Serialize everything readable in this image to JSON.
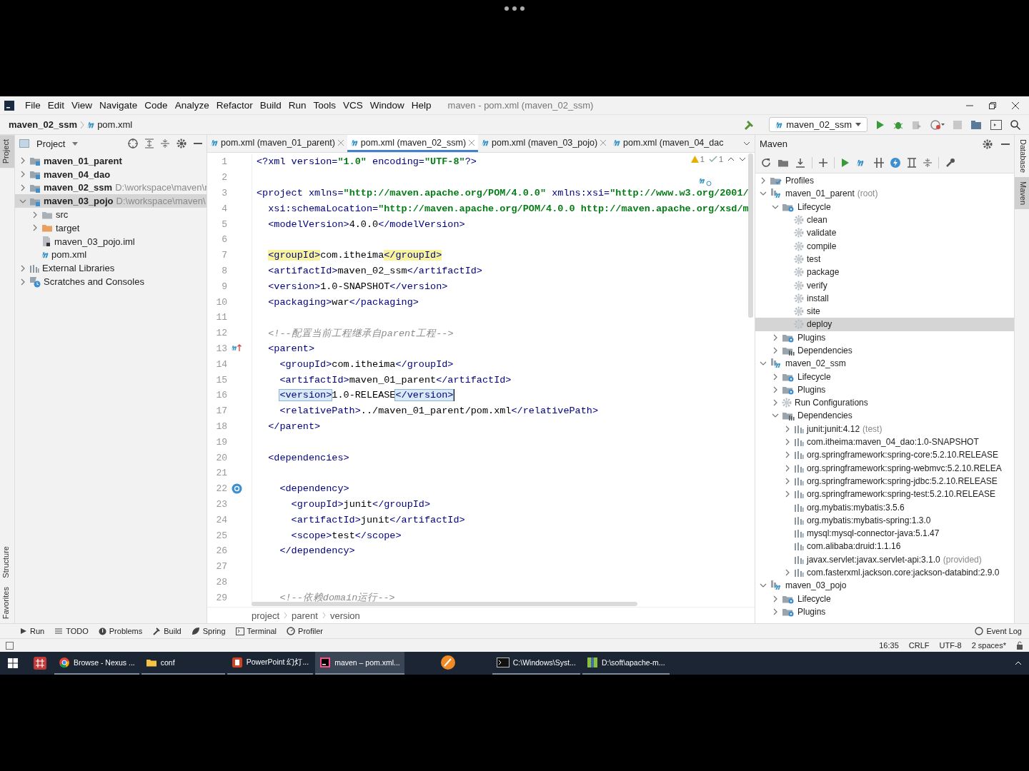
{
  "window": {
    "title": "maven - pom.xml (maven_02_ssm)"
  },
  "menu": [
    "File",
    "Edit",
    "View",
    "Navigate",
    "Code",
    "Analyze",
    "Refactor",
    "Build",
    "Run",
    "Tools",
    "VCS",
    "Window",
    "Help"
  ],
  "nav": {
    "module": "maven_02_ssm",
    "file": "pom.xml"
  },
  "toolbar": {
    "run_config": "maven_02_ssm"
  },
  "left_stripe": [
    {
      "label": "Project",
      "selected": true
    },
    {
      "label": "Structure",
      "selected": false
    },
    {
      "label": "Favorites",
      "selected": false
    }
  ],
  "right_stripe": [
    {
      "label": "Database",
      "selected": false
    },
    {
      "label": "Maven",
      "selected": true
    }
  ],
  "project": {
    "title": "Project",
    "tree": [
      {
        "label": "maven_01_parent",
        "kind": "module",
        "expanded": false,
        "selected": false
      },
      {
        "label": "maven_04_dao",
        "kind": "module",
        "expanded": false,
        "selected": false
      },
      {
        "label": "maven_02_ssm",
        "path": "D:\\workspace\\maven\\r",
        "kind": "module",
        "expanded": false,
        "selected": false
      },
      {
        "label": "maven_03_pojo",
        "path": "D:\\workspace\\maven\\",
        "kind": "module",
        "expanded": true,
        "selected": true,
        "children": [
          {
            "label": "src",
            "kind": "folder",
            "expanded": false
          },
          {
            "label": "target",
            "kind": "excluded",
            "expanded": false
          },
          {
            "label": "maven_03_pojo.iml",
            "kind": "iml"
          },
          {
            "label": "pom.xml",
            "kind": "pom"
          }
        ]
      },
      {
        "label": "External Libraries",
        "kind": "libraries",
        "expanded": false,
        "selected": false
      },
      {
        "label": "Scratches and Consoles",
        "kind": "scratches",
        "expanded": false,
        "selected": false
      }
    ]
  },
  "tabs": [
    {
      "label": "pom.xml (maven_01_parent)",
      "selected": false,
      "closable": true
    },
    {
      "label": "pom.xml (maven_02_ssm)",
      "selected": true,
      "closable": true
    },
    {
      "label": "pom.xml (maven_03_pojo)",
      "selected": false,
      "closable": true
    },
    {
      "label": "pom.xml (maven_04_dac",
      "selected": false,
      "closable": false
    }
  ],
  "editor": {
    "warnings": "1",
    "weak_warnings": "1",
    "lines": [
      {
        "n": "1",
        "text": "<?xml version=\"1.0\" encoding=\"UTF-8\"?>"
      },
      {
        "n": "2"
      },
      {
        "n": "3",
        "text": "<project xmlns=\"http://maven.apache.org/POM/4.0.0\" xmlns:xsi=\"http://www.w3.org/2001/"
      },
      {
        "n": "4",
        "text": "  xsi:schemaLocation=\"http://maven.apache.org/POM/4.0.0 http://maven.apache.org/xsd/m"
      },
      {
        "n": "5",
        "text": "  <modelVersion>4.0.0</modelVersion>"
      },
      {
        "n": "6"
      },
      {
        "n": "7",
        "text": "  <groupId>com.itheima</groupId>",
        "tag_match": true
      },
      {
        "n": "8",
        "text": "  <artifactId>maven_02_ssm</artifactId>"
      },
      {
        "n": "9",
        "text": "  <version>1.0-SNAPSHOT</version>"
      },
      {
        "n": "10",
        "text": "  <packaging>war</packaging>"
      },
      {
        "n": "11"
      },
      {
        "n": "12",
        "text": "  <!--配置当前工程继承自parent工程-->"
      },
      {
        "n": "13",
        "text": "  <parent>",
        "override_marker": true
      },
      {
        "n": "14",
        "text": "    <groupId>com.itheima</groupId>"
      },
      {
        "n": "15",
        "text": "    <artifactId>maven_01_parent</artifactId>"
      },
      {
        "n": "16",
        "text": "    <version>1.0-RELEASE</version>",
        "tag_pair": true,
        "caret": true
      },
      {
        "n": "17",
        "text": "    <relativePath>../maven_01_parent/pom.xml</relativePath>"
      },
      {
        "n": "18",
        "text": "  </parent>"
      },
      {
        "n": "19"
      },
      {
        "n": "20",
        "text": "  <dependencies>"
      },
      {
        "n": "21"
      },
      {
        "n": "22",
        "text": "    <dependency>",
        "dependency_marker": true
      },
      {
        "n": "23",
        "text": "      <groupId>junit</groupId>"
      },
      {
        "n": "24",
        "text": "      <artifactId>junit</artifactId>"
      },
      {
        "n": "25",
        "text": "      <scope>test</scope>"
      },
      {
        "n": "26",
        "text": "    </dependency>"
      },
      {
        "n": "27"
      },
      {
        "n": "28"
      },
      {
        "n": "29",
        "text": "    <!--依赖domain运行-->"
      }
    ],
    "breadcrumb": [
      "project",
      "parent",
      "version"
    ]
  },
  "maven": {
    "title": "Maven",
    "tree": [
      {
        "label": "Profiles",
        "kind": "profiles",
        "expanded": false
      },
      {
        "label": "maven_01_parent",
        "note": "(root)",
        "kind": "project",
        "expanded": true,
        "children": [
          {
            "label": "Lifecycle",
            "kind": "lifecycle",
            "expanded": true,
            "children": [
              {
                "label": "clean",
                "kind": "goal",
                "selected": false
              },
              {
                "label": "validate",
                "kind": "goal",
                "selected": false
              },
              {
                "label": "compile",
                "kind": "goal",
                "selected": false
              },
              {
                "label": "test",
                "kind": "goal",
                "selected": false
              },
              {
                "label": "package",
                "kind": "goal",
                "selected": false
              },
              {
                "label": "verify",
                "kind": "goal",
                "selected": false
              },
              {
                "label": "install",
                "kind": "goal",
                "selected": false
              },
              {
                "label": "site",
                "kind": "goal",
                "selected": false
              },
              {
                "label": "deploy",
                "kind": "goal",
                "selected": true
              }
            ]
          },
          {
            "label": "Plugins",
            "kind": "lifecycle",
            "expanded": false
          },
          {
            "label": "Dependencies",
            "kind": "dependencies",
            "expanded": false
          }
        ]
      },
      {
        "label": "maven_02_ssm",
        "kind": "project",
        "expanded": true,
        "children": [
          {
            "label": "Lifecycle",
            "kind": "lifecycle",
            "expanded": false
          },
          {
            "label": "Plugins",
            "kind": "lifecycle",
            "expanded": false
          },
          {
            "label": "Run Configurations",
            "kind": "runconfig",
            "expanded": false
          },
          {
            "label": "Dependencies",
            "kind": "dependencies",
            "expanded": true,
            "children": [
              {
                "label": "junit:junit:4.12",
                "note": "(test)",
                "kind": "dependency",
                "expanded": false
              },
              {
                "label": "com.itheima:maven_04_dao:1.0-SNAPSHOT",
                "kind": "dependency",
                "expanded": false
              },
              {
                "label": "org.springframework:spring-core:5.2.10.RELEASE",
                "kind": "dependency",
                "expanded": false
              },
              {
                "label": "org.springframework:spring-webmvc:5.2.10.RELEA",
                "kind": "dependency",
                "expanded": false
              },
              {
                "label": "org.springframework:spring-jdbc:5.2.10.RELEASE",
                "kind": "dependency",
                "expanded": false
              },
              {
                "label": "org.springframework:spring-test:5.2.10.RELEASE",
                "kind": "dependency",
                "expanded": false
              },
              {
                "label": "org.mybatis:mybatis:3.5.6",
                "kind": "dependency"
              },
              {
                "label": "org.mybatis:mybatis-spring:1.3.0",
                "kind": "dependency"
              },
              {
                "label": "mysql:mysql-connector-java:5.1.47",
                "kind": "dependency"
              },
              {
                "label": "com.alibaba:druid:1.1.16",
                "kind": "dependency"
              },
              {
                "label": "javax.servlet:javax.servlet-api:3.1.0",
                "note": "(provided)",
                "kind": "dependency"
              },
              {
                "label": "com.fasterxml.jackson.core:jackson-databind:2.9.0",
                "kind": "dependency",
                "expanded": false
              }
            ]
          }
        ]
      },
      {
        "label": "maven_03_pojo",
        "kind": "project",
        "expanded": true,
        "children": [
          {
            "label": "Lifecycle",
            "kind": "lifecycle",
            "expanded": false
          },
          {
            "label": "Plugins",
            "kind": "lifecycle",
            "expanded": false
          }
        ]
      }
    ]
  },
  "tool_windows": [
    {
      "label": "Run",
      "kind": "run"
    },
    {
      "label": "TODO",
      "kind": "todo"
    },
    {
      "label": "Problems",
      "kind": "problems"
    },
    {
      "label": "Build",
      "kind": "build"
    },
    {
      "label": "Spring",
      "kind": "spring"
    },
    {
      "label": "Terminal",
      "kind": "terminal"
    },
    {
      "label": "Profiler",
      "kind": "profiler"
    }
  ],
  "event_log": "Event Log",
  "status": [
    "16:35",
    "CRLF",
    "UTF-8",
    "2 spaces*"
  ],
  "taskbar": [
    {
      "label": "Browse - Nexus ...",
      "kind": "browser",
      "selected": false
    },
    {
      "label": "conf",
      "kind": "folder",
      "selected": false
    },
    {
      "label": "PowerPoint 幻灯...",
      "kind": "slides",
      "selected": false
    },
    {
      "label": "maven – pom.xml...",
      "kind": "ide",
      "selected": true
    },
    {
      "kind": "orange",
      "selected": false
    },
    {
      "label": "C:\\Windows\\Syst...",
      "kind": "console",
      "selected": false
    },
    {
      "label": "D:\\soft\\apache-m...",
      "kind": "archive",
      "selected": false
    }
  ]
}
